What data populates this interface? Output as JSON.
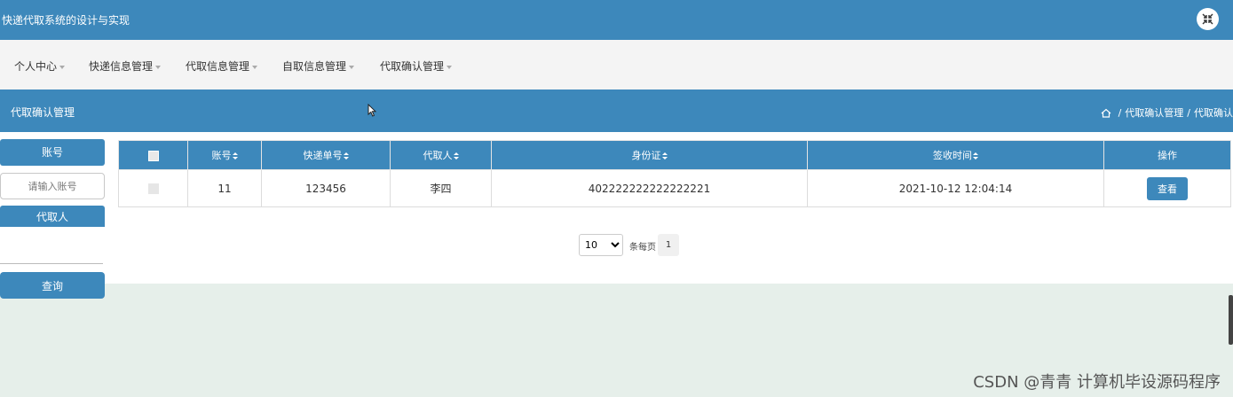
{
  "app": {
    "title": "快递代取系统的设计与实现"
  },
  "nav": {
    "items": [
      {
        "label": "个人中心"
      },
      {
        "label": "快递信息管理"
      },
      {
        "label": "代取信息管理"
      },
      {
        "label": "自取信息管理"
      },
      {
        "label": "代取确认管理"
      }
    ]
  },
  "page": {
    "title": "代取确认管理",
    "breadcrumb": [
      "代取确认管理",
      "代取确认"
    ]
  },
  "sidebar": {
    "account_label": "账号",
    "account_placeholder": "请输入账号",
    "agent_label": "代取人",
    "query_label": "查询"
  },
  "table": {
    "columns": [
      "账号",
      "快递单号",
      "代取人",
      "身份证",
      "签收时间",
      "操作"
    ],
    "rows": [
      {
        "account": "11",
        "tracking": "123456",
        "agent": "李四",
        "id_card": "402222222222222221",
        "signed_at": "2021-10-12 12:04:14",
        "action": "查看"
      }
    ]
  },
  "pagination": {
    "page_size": "10",
    "per_page_label": "条每页",
    "current_page": "1"
  },
  "watermark": "CSDN @青青  计算机毕设源码程序",
  "colors": {
    "primary": "#3d88bb",
    "nav_bg": "#f4f4f4",
    "footer_bg": "#e6efea"
  }
}
